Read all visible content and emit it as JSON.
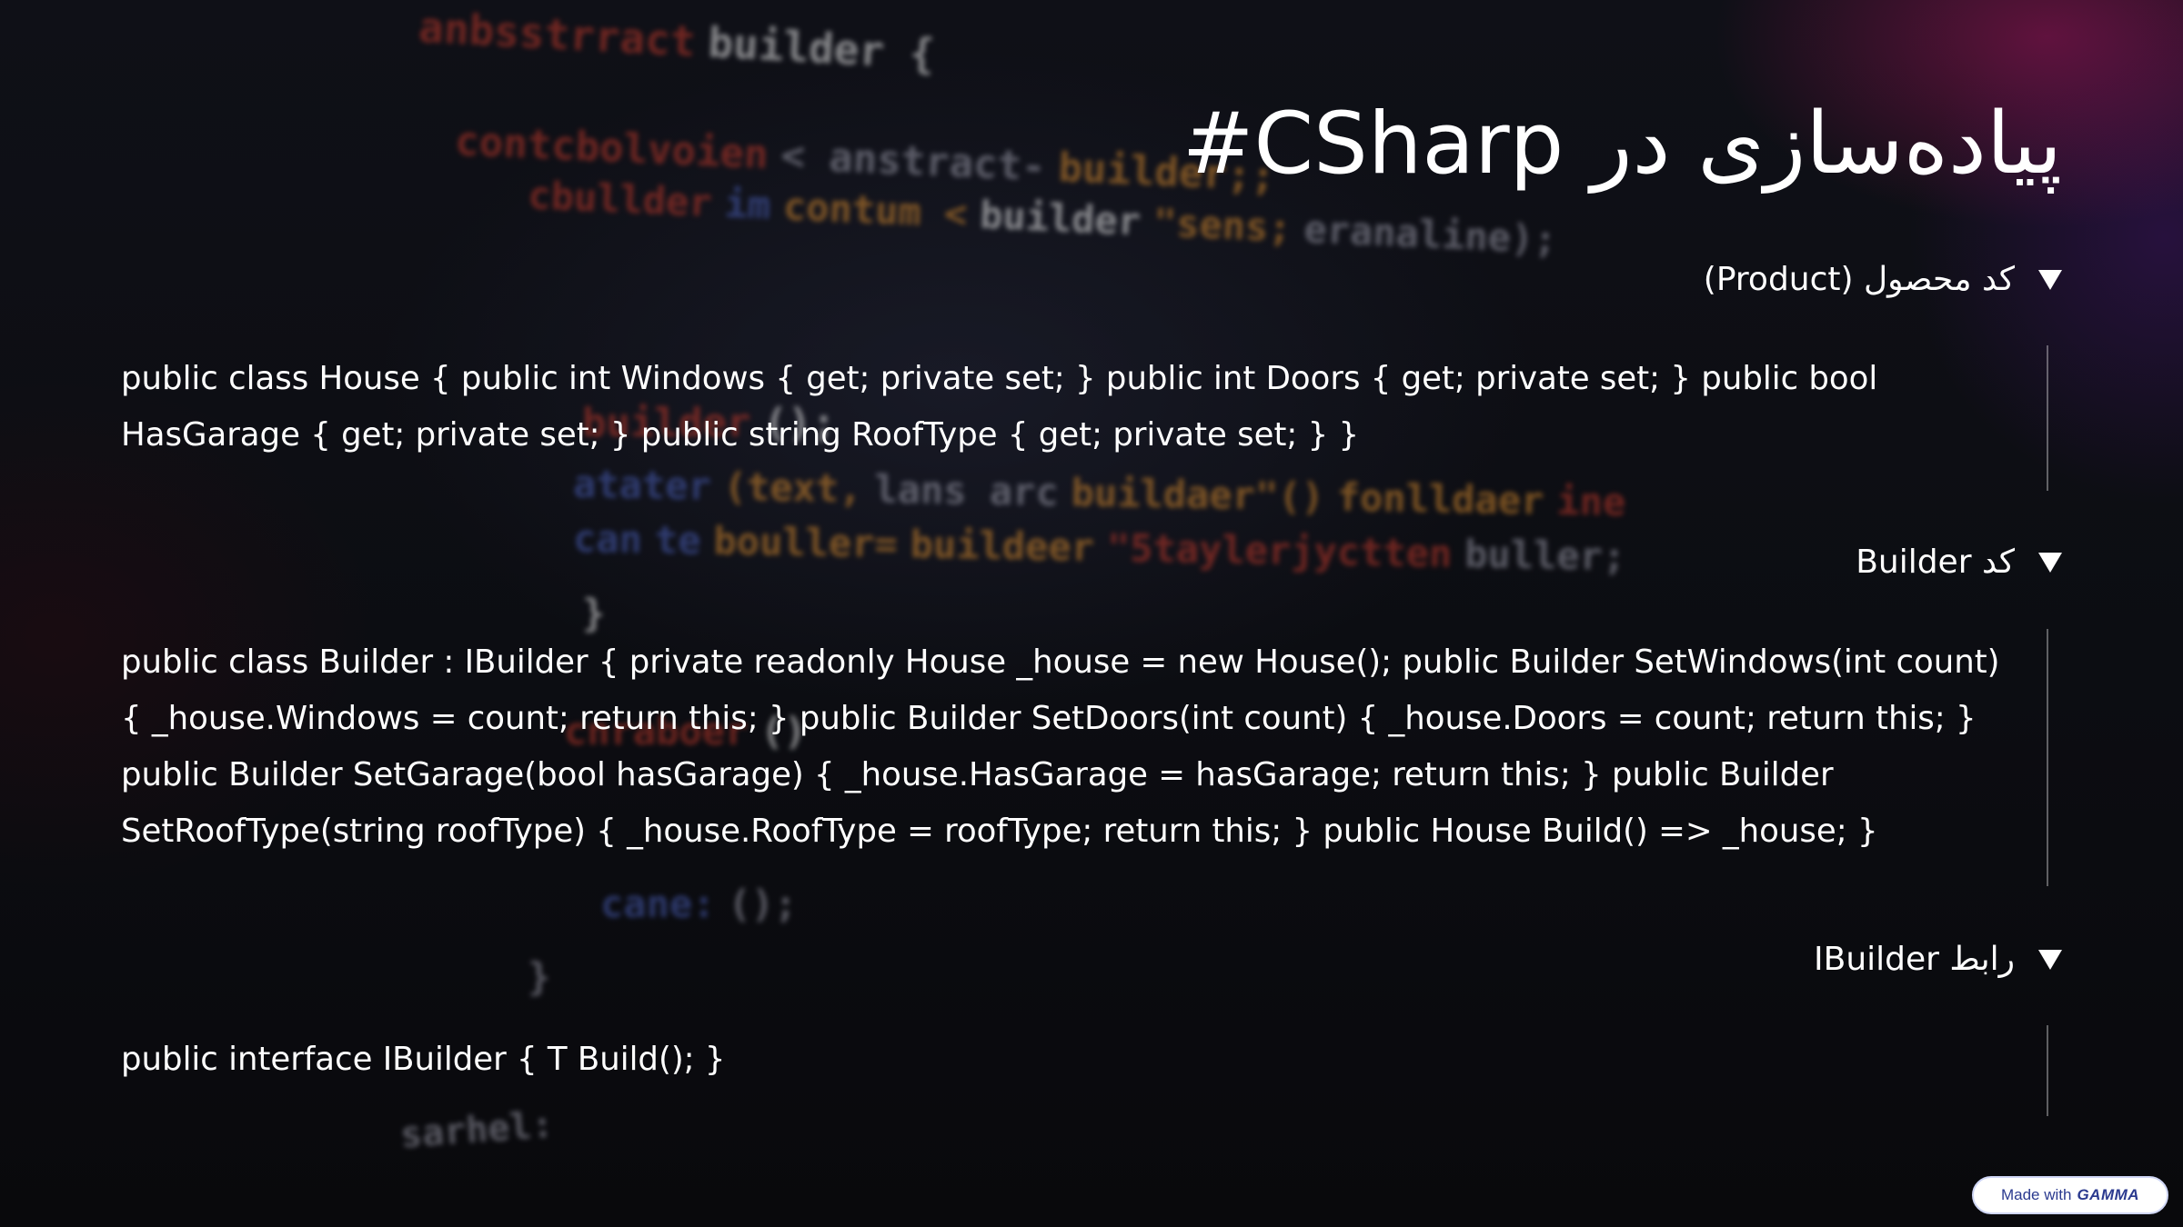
{
  "slide": {
    "title": "پیاده‌سازی در CSharp#"
  },
  "sections": [
    {
      "heading": "کد محصول (Product)",
      "code": "public class House { public int Windows { get; private set; } public int Doors { get; private set; } public bool HasGarage { get; private set; } public string RoofType { get; private set; } }"
    },
    {
      "heading": "کد Builder",
      "code": "public class Builder : IBuilder { private readonly House _house = new House(); public Builder SetWindows(int count) { _house.Windows = count; return this; } public Builder SetDoors(int count) { _house.Doors = count; return this; } public Builder SetGarage(bool hasGarage) { _house.HasGarage = hasGarage; return this; } public Builder SetRoofType(string roofType) { _house.RoofType = roofType; return this; } public House Build() => _house; }"
    },
    {
      "heading": "رابط IBuilder",
      "code": "public interface IBuilder { T Build(); }"
    }
  ],
  "badge": {
    "prefix": "Made with",
    "brand": "GAMMA"
  },
  "background_code": {
    "lines": [
      [
        "anbsstrract",
        "builder {"
      ],
      [
        "contcbolvoien",
        "< anstract-",
        "builder;;"
      ],
      [
        "cbullder",
        "im",
        "contum <",
        "builder",
        "\"sens;",
        "eranaline);"
      ],
      [
        "",
        "{",
        ""
      ],
      [
        "builder",
        "();"
      ],
      [
        "atater",
        "(text,",
        "lans arc",
        "buildaer\"()",
        "fonlldaer",
        "ine"
      ],
      [
        "can",
        "te",
        "bouller=",
        "buildeer",
        "\"5taylerjyctten",
        "buller;"
      ],
      [
        "}"
      ],
      [
        "cnraboer",
        "()"
      ],
      [
        "cane:",
        "();"
      ],
      [
        "}"
      ],
      [
        "sarhel:"
      ]
    ],
    "colors": {
      "red": "#c0392b",
      "orange": "#d68a2e",
      "white": "#e8e8e8",
      "blue": "#4a5fb8",
      "gray": "#9a9aa8"
    }
  }
}
